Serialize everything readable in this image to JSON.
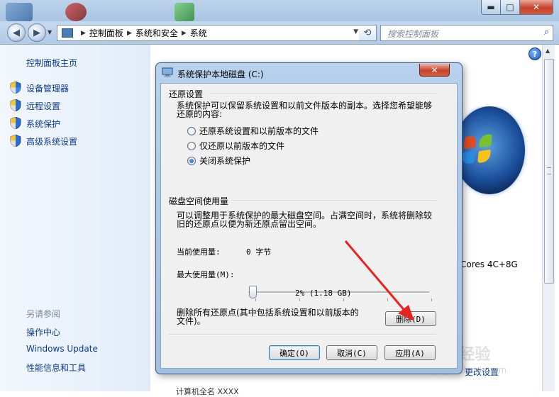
{
  "window": {
    "controls": {
      "minimize": "▬",
      "maximize": "□",
      "close": "✕"
    }
  },
  "navbar": {
    "back_glyph": "◀",
    "forward_glyph": "▶",
    "history_glyph": "▼",
    "breadcrumbs": [
      "控制面板",
      "系统和安全",
      "系统"
    ],
    "refresh_glyph": "⟲",
    "search_placeholder": "搜索控制面板",
    "search_glyph": "⌕"
  },
  "sidebar": {
    "home_link": "控制面板主页",
    "task_links": [
      "设备管理器",
      "远程设置",
      "系统保护",
      "高级系统设置"
    ],
    "see_also_heading": "另请参阅",
    "see_also_links": [
      "操作中心",
      "Windows Update",
      "性能信息和工具"
    ]
  },
  "content": {
    "help_glyph": "?",
    "cpu_fragment": "Cores 4C+8G",
    "change_settings_link": "更改设置",
    "bottom_cutoff": "计算机全名          XXXX"
  },
  "watermark": {
    "logo": "Bai 经验",
    "url": "jingyan.baidu.com"
  },
  "dialog": {
    "title": "系统保护本地磁盘 (C:)",
    "close_glyph": "✕",
    "restore_settings": {
      "heading": "还原设置",
      "description_line1": "系统保护可以保留系统设置和以前文件版本的副本。选择您希望能够",
      "description_line2": "还原的内容:",
      "options": [
        {
          "label": "还原系统设置和以前版本的文件",
          "selected": false
        },
        {
          "label": "仅还原以前版本的文件",
          "selected": false
        },
        {
          "label": "关闭系统保护",
          "selected": true
        }
      ]
    },
    "disk_usage": {
      "heading": "磁盘空间使用量",
      "description_line1": "可以调整用于系统保护的最大磁盘空间。占满空间时，系统将删除较",
      "description_line2": "旧的还原点以便为新还原点留出空间。",
      "current_usage_label": "当前使用量:",
      "current_usage_value": "0 字节",
      "max_usage_label": "最大使用量(M):",
      "max_usage_percent": 2,
      "max_usage_readout": "2% (1.18 GB)",
      "delete_text_line1": "删除所有还原点(其中包括系统设置和以前版本的",
      "delete_text_line2": "文件)。",
      "delete_button": "删除(D)"
    },
    "buttons": {
      "ok": "确定(O)",
      "cancel": "取消(C)",
      "apply": "应用(A)"
    }
  }
}
